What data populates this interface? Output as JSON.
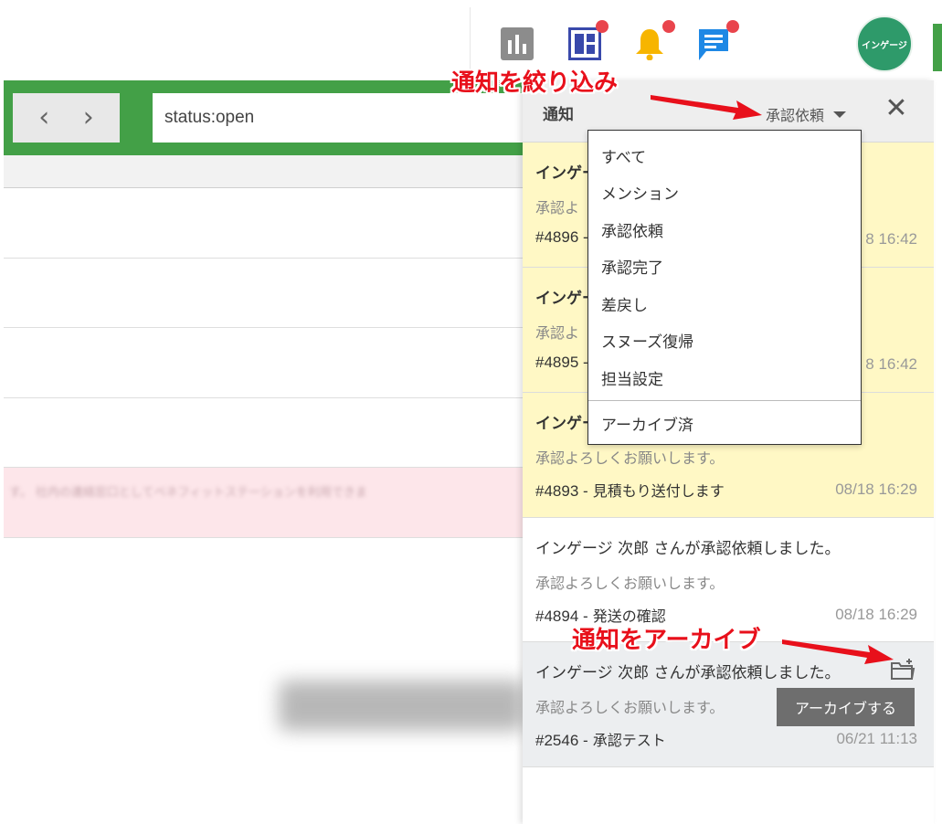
{
  "header": {
    "avatar_text": "インゲージ",
    "icons": [
      "bar-chart-icon",
      "dashboard-icon",
      "bell-icon",
      "chat-icon"
    ],
    "colors": {
      "chart": "#8c8c8c",
      "dashboard": "#3949ab",
      "bell": "#f7b500",
      "chat": "#1e88e5",
      "badge": "#e9444c",
      "avatar": "#2e9a6a"
    }
  },
  "toolbar": {
    "prev_label": "‹",
    "next_label": "›",
    "search_value": "status:open",
    "accent": "#43a047"
  },
  "panel": {
    "title": "通知",
    "filter_value": "承認依頼",
    "close_label": "✕"
  },
  "filter_menu": {
    "items": [
      "すべて",
      "メンション",
      "承認依頼",
      "承認完了",
      "差戻し",
      "スヌーズ復帰",
      "担当設定"
    ],
    "archived": "アーカイブ済"
  },
  "notifications": [
    {
      "title": "インゲー",
      "body": "承認よ",
      "id": "#4896 -",
      "subject": "",
      "time": "8 16:42",
      "state": "unread"
    },
    {
      "title": "インゲー",
      "body": "承認よ",
      "id": "#4895 -",
      "subject": "",
      "time": "8 16:42",
      "state": "unread"
    },
    {
      "title": "インゲー",
      "body": "承認よろしくお願いします。",
      "id": "#4893 -",
      "subject": "見積もり送付します",
      "time": "08/18 16:29",
      "state": "unread"
    },
    {
      "title": "インゲージ 次郎 さんが承認依頼しました。",
      "body": "承認よろしくお願いします。",
      "id": "#4894 -",
      "subject": "発送の確認",
      "time": "08/18 16:29",
      "state": "read"
    },
    {
      "title": "インゲージ 次郎 さんが承認依頼しました。",
      "body": "承認よろしくお願いします。",
      "id": "#2546 -",
      "subject": "承認テスト",
      "time": "06/21 11:13",
      "state": "hover"
    }
  ],
  "archive_tooltip": "アーカイブする",
  "annotations": {
    "filter": "通知を絞り込み",
    "archive": "通知をアーカイブ",
    "color": "#e8101b"
  },
  "background": {
    "pink_row_text": "す。 社内の連絡窓口としてベネフィットステーションを利用できま"
  }
}
